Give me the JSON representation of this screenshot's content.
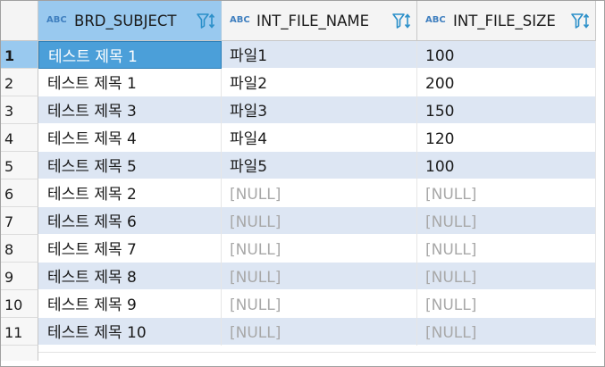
{
  "columns": [
    {
      "type_badge": "ABC",
      "name": "BRD_SUBJECT",
      "filter_icon": "filter-sort-icon",
      "selected": true
    },
    {
      "type_badge": "ABC",
      "name": "INT_FILE_NAME",
      "filter_icon": "filter-sort-icon",
      "selected": false
    },
    {
      "type_badge": "ABC",
      "name": "INT_FILE_SIZE",
      "filter_icon": "filter-sort-icon",
      "selected": false
    }
  ],
  "rows": [
    {
      "num": "1",
      "subject": "테스트 제목 1",
      "file_name": "파일1",
      "file_size": "100"
    },
    {
      "num": "2",
      "subject": "테스트 제목 1",
      "file_name": "파일2",
      "file_size": "200"
    },
    {
      "num": "3",
      "subject": "테스트 제목 3",
      "file_name": "파일3",
      "file_size": "150"
    },
    {
      "num": "4",
      "subject": "테스트 제목 4",
      "file_name": "파일4",
      "file_size": "120"
    },
    {
      "num": "5",
      "subject": "테스트 제목 5",
      "file_name": "파일5",
      "file_size": "100"
    },
    {
      "num": "6",
      "subject": "테스트 제목 2",
      "file_name": "[NULL]",
      "file_size": "[NULL]"
    },
    {
      "num": "7",
      "subject": "테스트 제목 6",
      "file_name": "[NULL]",
      "file_size": "[NULL]"
    },
    {
      "num": "8",
      "subject": "테스트 제목 7",
      "file_name": "[NULL]",
      "file_size": "[NULL]"
    },
    {
      "num": "9",
      "subject": "테스트 제목 8",
      "file_name": "[NULL]",
      "file_size": "[NULL]"
    },
    {
      "num": "10",
      "subject": "테스트 제목 9",
      "file_name": "[NULL]",
      "file_size": "[NULL]"
    },
    {
      "num": "11",
      "subject": "테스트 제목 10",
      "file_name": "[NULL]",
      "file_size": "[NULL]"
    }
  ],
  "null_text": "[NULL]",
  "colors": {
    "selected_header": "#99c9ef",
    "active_cell": "#4b9fd9",
    "odd_row": "#dde6f3",
    "null_text": "#a8a8a8",
    "type_badge": "#3f7fbf",
    "filter_icon": "#2a8fc9"
  }
}
